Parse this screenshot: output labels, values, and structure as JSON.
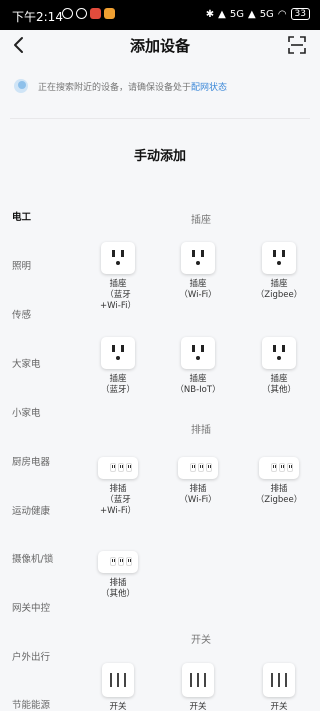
{
  "status_bar": {
    "time": "下午2:14",
    "network": "5G",
    "network2": "5G",
    "battery": "33"
  },
  "header": {
    "title": "添加设备"
  },
  "search": {
    "text": "正在搜索附近的设备，请确保设备处于",
    "link": "配网状态"
  },
  "section_heading": "手动添加",
  "categories": [
    "电工",
    "照明",
    "传感",
    "大家电",
    "小家电",
    "厨房电器",
    "运动健康",
    "摄像机/锁",
    "网关中控",
    "户外出行",
    "节能能源"
  ],
  "groups": {
    "socket": {
      "title": "插座",
      "items": [
        "插座\n（蓝牙\n+Wi-Fi）",
        "插座\n（Wi-Fi）",
        "插座\n（Zigbee）",
        "插座\n（蓝牙）",
        "插座\n（NB-IoT）",
        "插座\n（其他）"
      ]
    },
    "strip": {
      "title": "排插",
      "items": [
        "排插\n（蓝牙\n+Wi-Fi）",
        "排插\n（Wi-Fi）",
        "排插\n（Zigbee）",
        "排插\n（其他）"
      ]
    },
    "switch": {
      "title": "开关",
      "items": [
        "开关",
        "开关",
        "开关"
      ]
    }
  }
}
